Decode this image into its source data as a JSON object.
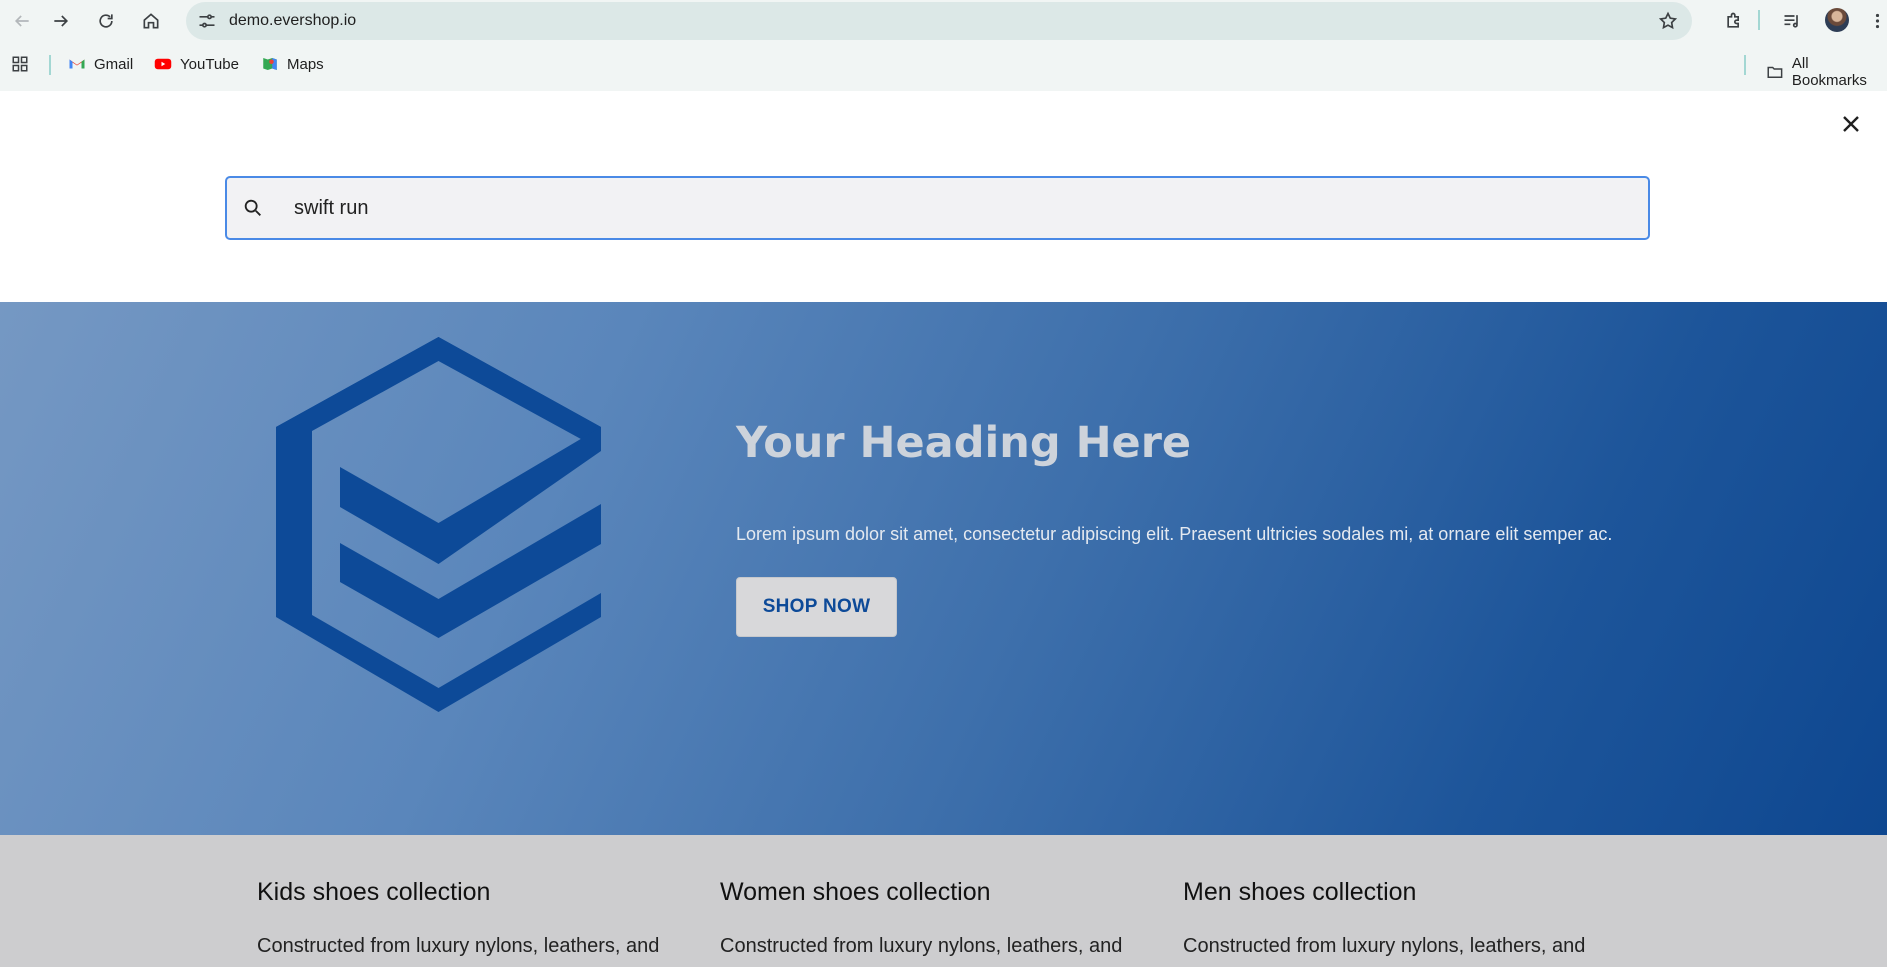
{
  "browser": {
    "url": "demo.evershop.io",
    "bookmarks": [
      {
        "label": "Gmail",
        "icon": "gmail-icon"
      },
      {
        "label": "YouTube",
        "icon": "youtube-icon"
      },
      {
        "label": "Maps",
        "icon": "maps-icon"
      }
    ],
    "all_bookmarks_label": "All Bookmarks"
  },
  "search": {
    "value": "swift run",
    "icon": "search-icon"
  },
  "hero": {
    "heading": "Your Heading Here",
    "text": "Lorem ipsum dolor sit amet, consectetur adipiscing elit. Praesent ultricies sodales mi, at ornare elit semper ac.",
    "button_label": "SHOP NOW",
    "logo_color": "#0d4a98",
    "bg_start": "#7598c3",
    "bg_end": "#0e4790"
  },
  "collections": [
    {
      "title": "Kids shoes collection",
      "text": "Constructed from luxury nylons, leathers, and"
    },
    {
      "title": "Women shoes collection",
      "text": "Constructed from luxury nylons, leathers, and"
    },
    {
      "title": "Men shoes collection",
      "text": "Constructed from luxury nylons, leathers, and"
    }
  ]
}
